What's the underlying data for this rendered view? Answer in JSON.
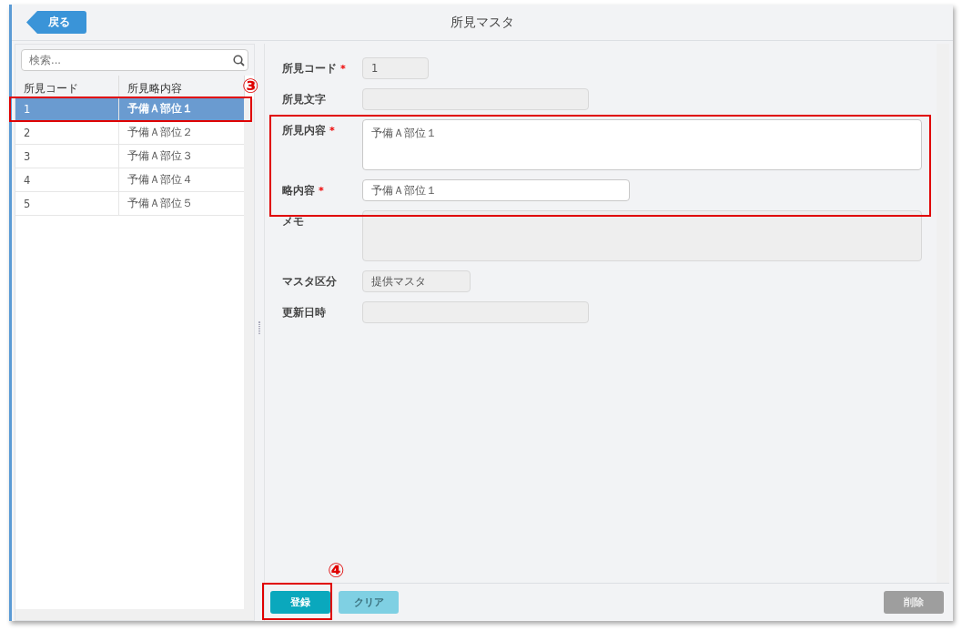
{
  "header": {
    "back_button": "戻る",
    "title": "所見マスタ"
  },
  "search": {
    "placeholder": "検索..."
  },
  "table": {
    "columns": [
      "所見コード",
      "所見略内容"
    ],
    "rows": [
      {
        "code": "1",
        "text": "予備Ａ部位１",
        "selected": true
      },
      {
        "code": "2",
        "text": "予備Ａ部位２",
        "selected": false
      },
      {
        "code": "3",
        "text": "予備Ａ部位３",
        "selected": false
      },
      {
        "code": "4",
        "text": "予備Ａ部位４",
        "selected": false
      },
      {
        "code": "5",
        "text": "予備Ａ部位５",
        "selected": false
      }
    ]
  },
  "form": {
    "required_mark": "*",
    "fields": [
      {
        "label": "所見コード",
        "required": true,
        "kind": "short",
        "value": "1",
        "disabled": true
      },
      {
        "label": "所見文字",
        "required": false,
        "kind": "medium",
        "disabled": true
      },
      {
        "label": "所見内容",
        "required": true,
        "kind": "textarea",
        "value": "予備Ａ部位１",
        "disabled": false
      },
      {
        "label": "略内容",
        "required": true,
        "kind": "long",
        "value": "予備Ａ部位１",
        "disabled": false
      },
      {
        "label": "メモ",
        "required": false,
        "kind": "textarea",
        "disabled": true
      },
      {
        "label": "マスタ区分",
        "required": false,
        "kind": "select",
        "value": "提供マスタ",
        "disabled": true
      },
      {
        "label": "更新日時",
        "required": false,
        "kind": "medium",
        "disabled": true
      }
    ]
  },
  "footer": {
    "buttons": [
      {
        "label": "登録",
        "kind": "primary"
      },
      {
        "label": "クリア",
        "kind": "secondary"
      },
      {
        "label": "削除",
        "kind": "danger"
      }
    ]
  },
  "annotations": [
    {
      "text": "③"
    },
    {
      "text": "④"
    }
  ]
}
